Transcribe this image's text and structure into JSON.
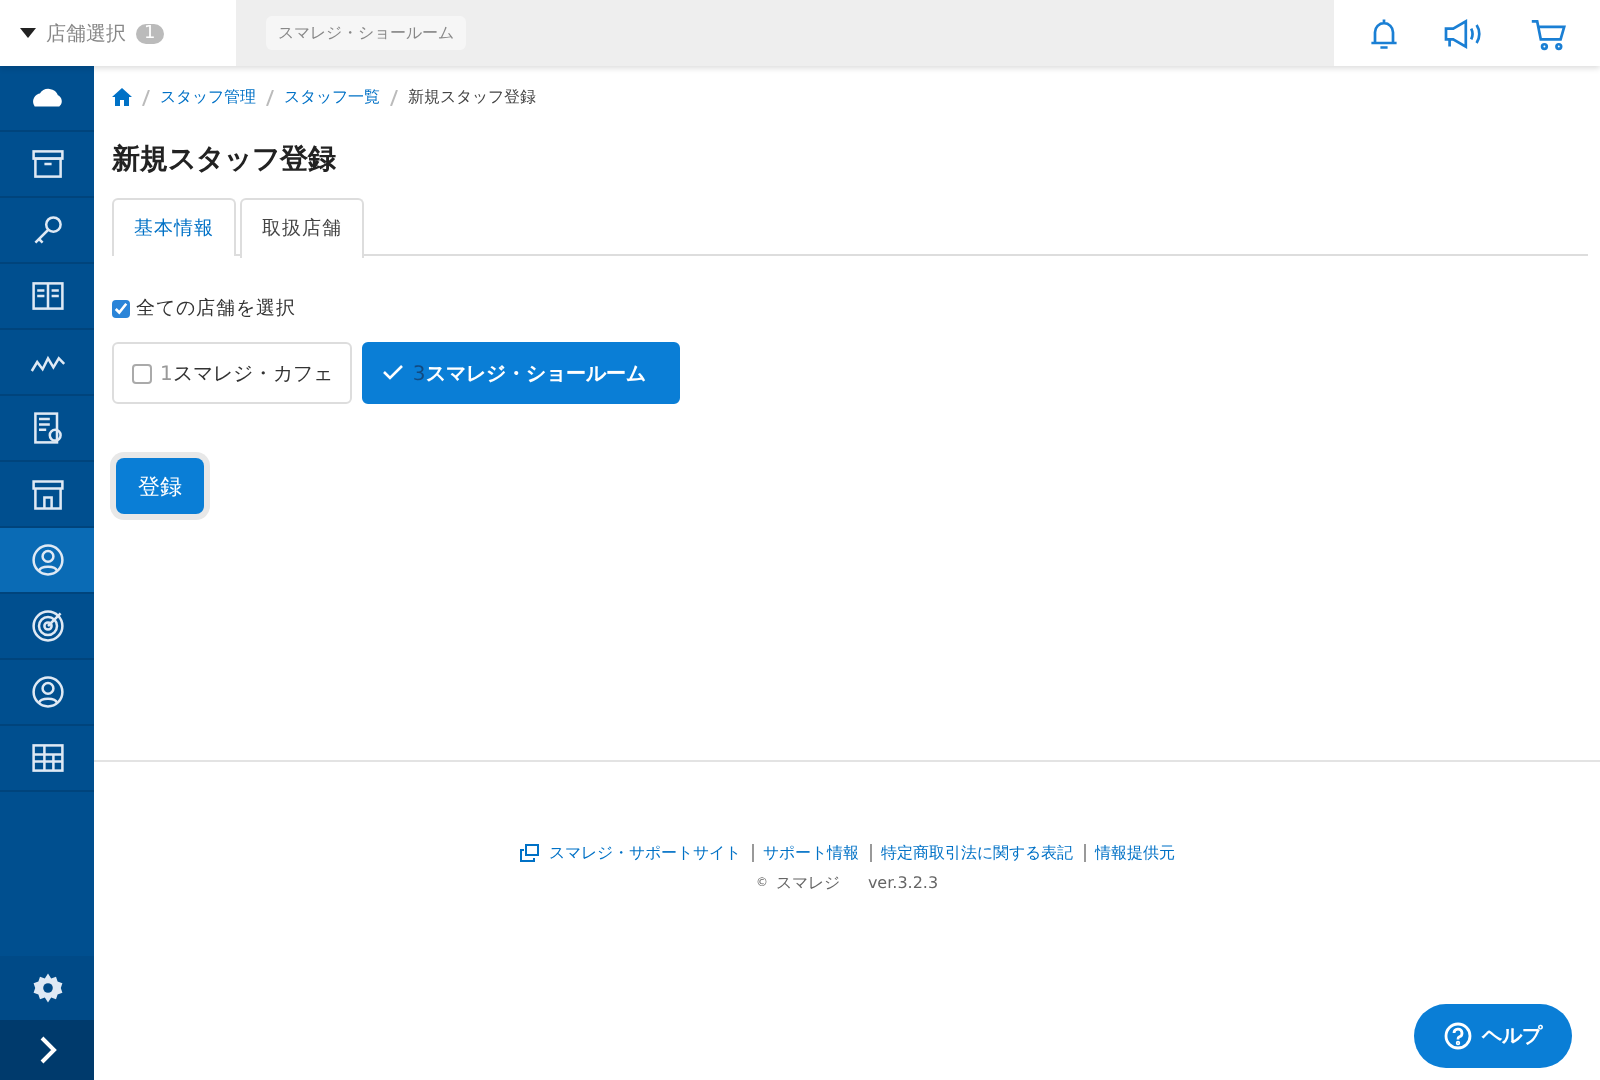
{
  "header": {
    "store_select": {
      "label": "店舗選択",
      "count": "1"
    },
    "current_store": "スマレジ・ショールーム"
  },
  "sidebar": {
    "items": [
      {
        "kind": "cloud",
        "selected": false
      },
      {
        "kind": "box",
        "selected": false
      },
      {
        "kind": "key",
        "selected": false
      },
      {
        "kind": "book",
        "selected": false
      },
      {
        "kind": "chart",
        "selected": false
      },
      {
        "kind": "report",
        "selected": false
      },
      {
        "kind": "shop",
        "selected": false
      },
      {
        "kind": "staff",
        "selected": true
      },
      {
        "kind": "target",
        "selected": false
      },
      {
        "kind": "person",
        "selected": false
      },
      {
        "kind": "grid",
        "selected": false
      }
    ]
  },
  "breadcrumb": [
    "スタッフ管理",
    "スタッフ一覧",
    "新規スタッフ登録"
  ],
  "page_title": "新規スタッフ登録",
  "tabs": [
    {
      "label": "基本情報",
      "selected": false
    },
    {
      "label": "取扱店舗",
      "selected": true
    }
  ],
  "select_all": {
    "label": "全ての店舗を選択",
    "checked": true
  },
  "stores": [
    {
      "number": "1",
      "name": "スマレジ・カフェ",
      "selected": false
    },
    {
      "number": "3",
      "name": "スマレジ・ショールーム",
      "selected": true
    }
  ],
  "submit_button": "登録",
  "footer": {
    "links": [
      "スマレジ・サポートサイト",
      "サポート情報",
      "特定商取引法に関する表記",
      "情報提供元"
    ],
    "copyright_mark": "©",
    "copyright": "スマレジ",
    "version": "ver.3.2.3"
  },
  "help_button": "ヘルプ"
}
